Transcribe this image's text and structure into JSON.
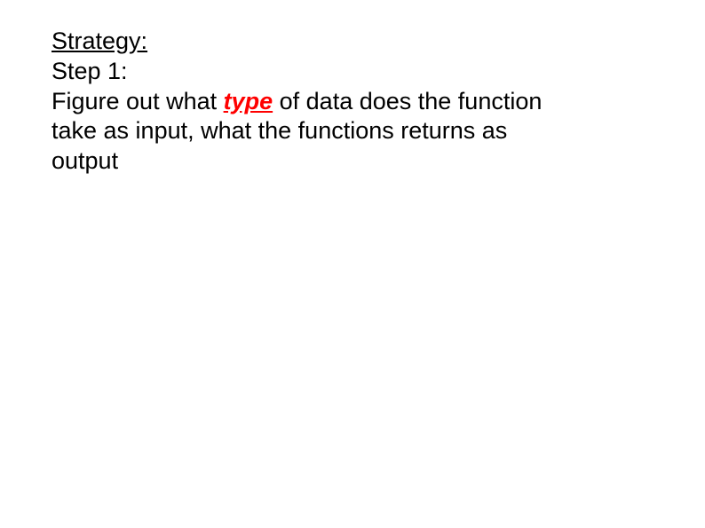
{
  "slide": {
    "heading": "Strategy:",
    "step_label": "Step 1:",
    "body_pre": "Figure out what ",
    "type_word": "type",
    "body_post": " of data does the function take as input, what the functions returns as output"
  }
}
